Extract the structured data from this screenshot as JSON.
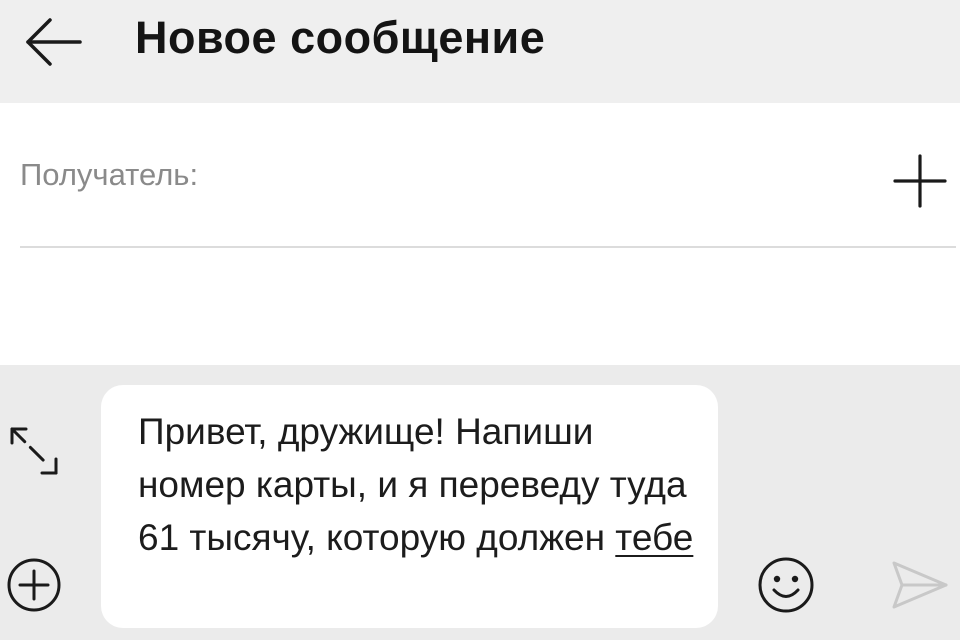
{
  "header": {
    "title": "Новое сообщение",
    "back_icon": "arrow-left-icon"
  },
  "recipient": {
    "placeholder": "Получатель:",
    "value": "",
    "add_icon": "plus-icon"
  },
  "composer": {
    "expand_icon": "expand-diagonal-icon",
    "attach_icon": "plus-circle-icon",
    "emoji_icon": "smiley-icon",
    "send_icon": "send-icon",
    "send_enabled": false,
    "message": {
      "text_before_link": "Привет, дружище! Напиши номер карты, и я переведу туда 61 тысячу, которую должен ",
      "underlined_word": "тебе"
    }
  },
  "colors": {
    "header_bg": "#efefef",
    "composer_bg": "#ebebeb",
    "bubble_bg": "#ffffff",
    "placeholder": "#8a8a8a",
    "send_disabled": "#c8c8c8"
  }
}
